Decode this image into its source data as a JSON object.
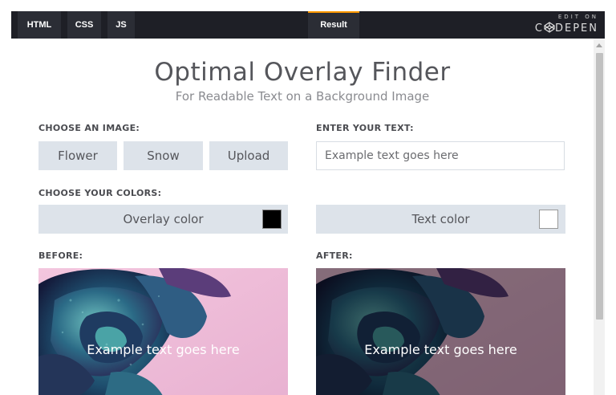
{
  "codepen": {
    "tabs": {
      "html": "HTML",
      "css": "CSS",
      "js": "JS",
      "result": "Result"
    },
    "edit_on": "EDIT ON",
    "brand": "DEPEN",
    "brand_prefix": "C"
  },
  "app": {
    "title": "Optimal Overlay Finder",
    "subtitle": "For Readable Text on a Background Image",
    "choose_image_label": "CHOOSE AN IMAGE:",
    "image_buttons": [
      "Flower",
      "Snow",
      "Upload"
    ],
    "enter_text_label": "ENTER YOUR TEXT:",
    "text_input_value": "Example text goes here",
    "choose_colors_label": "CHOOSE YOUR COLORS:",
    "overlay_color_label": "Overlay color",
    "overlay_color": "#000000",
    "text_color_label": "Text color",
    "text_color": "#ffffff",
    "before_label": "BEFORE:",
    "after_label": "AFTER:",
    "before_text": "Example text goes here",
    "after_text": "Example text goes here"
  }
}
